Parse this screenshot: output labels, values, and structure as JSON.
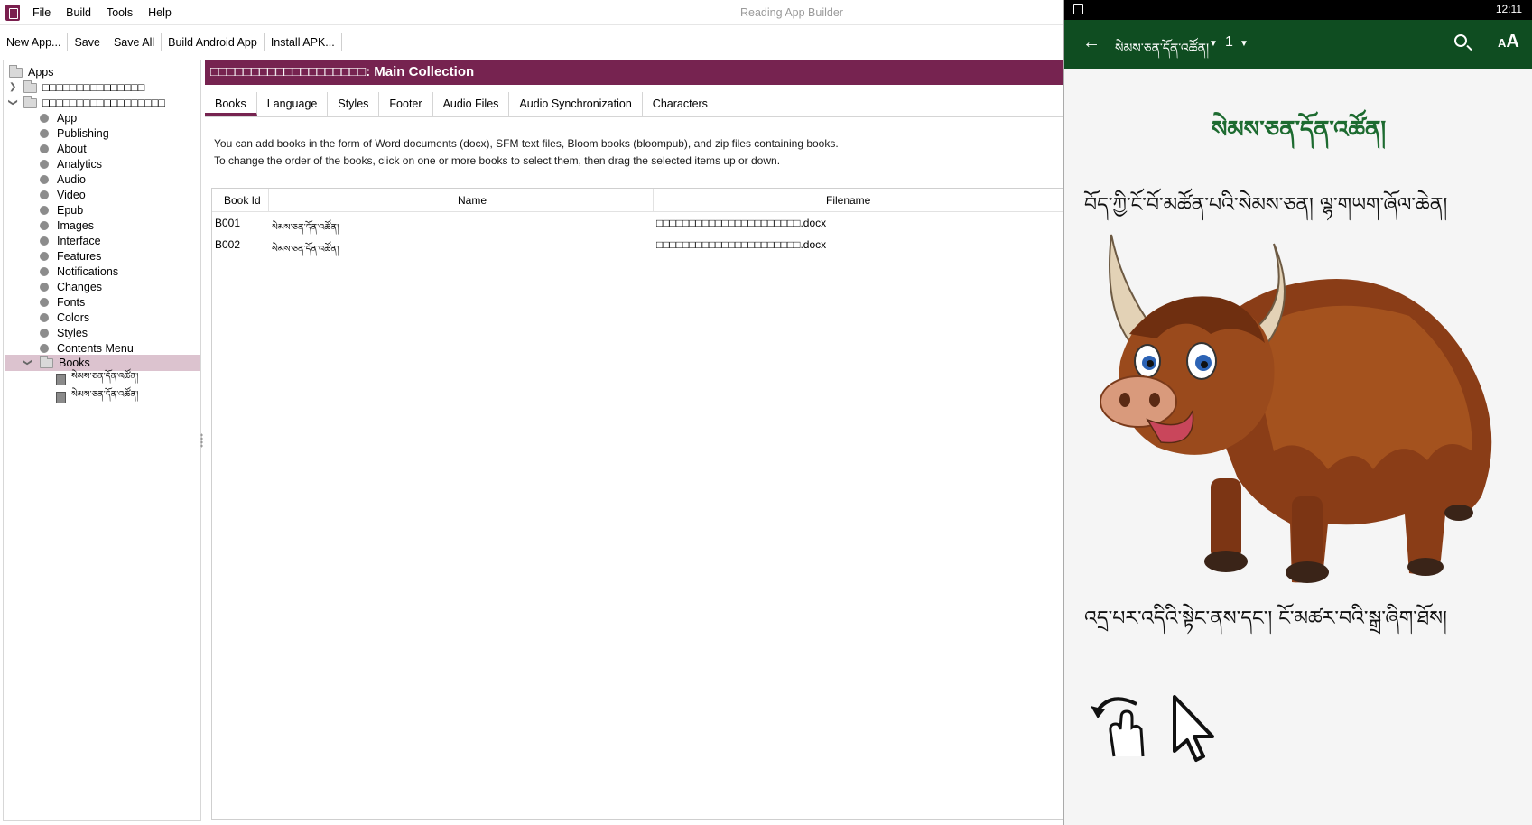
{
  "menubar": {
    "items": [
      "File",
      "Build",
      "Tools",
      "Help"
    ],
    "window_title": "Reading App Builder"
  },
  "toolbar": {
    "buttons": [
      "New App...",
      "Save",
      "Save All",
      "Build Android App",
      "Install APK..."
    ]
  },
  "tree": {
    "root": "Apps",
    "apps": [
      "□□□□□□□□□□□□□□□",
      "□□□□□□□□□□□□□□□□□□"
    ],
    "items": [
      "App",
      "Publishing",
      "About",
      "Analytics",
      "Audio",
      "Video",
      "Epub",
      "Images",
      "Interface",
      "Features",
      "Notifications",
      "Changes",
      "Fonts",
      "Colors",
      "Styles",
      "Contents Menu"
    ],
    "books_folder": "Books",
    "books": [
      "སེམས་ཅན་དོན་འཚོན།",
      "སེམས་ཅན་དོན་འཚོན།"
    ]
  },
  "collection": {
    "title": "□□□□□□□□□□□□□□□□□□□: Main Collection"
  },
  "tabs": [
    "Books",
    "Language",
    "Styles",
    "Footer",
    "Audio Files",
    "Audio Synchronization",
    "Characters"
  ],
  "info": {
    "line1": "You can add books in the form of Word documents (docx), SFM text files, Bloom books (bloompub), and zip files containing books.",
    "line2": "To change the order of the books, click on one or more books to select them, then drag the selected items up or down."
  },
  "grid": {
    "headers": [
      "Book Id",
      "Name",
      "Filename"
    ],
    "rows": [
      {
        "id": "B001",
        "name": "སེམས་ཅན་དོན་འཚོན།",
        "filename": "□□□□□□□□□□□□□□□□□□□□□□.docx"
      },
      {
        "id": "B002",
        "name": "སེམས་ཅན་དོན་འཚོན།",
        "filename": "□□□□□□□□□□□□□□□□□□□□□□.docx"
      }
    ]
  },
  "device": {
    "status_time": "12:11",
    "appbar_title": "སེམས་ཅན་དོན་འཚོན།",
    "chapter": "1",
    "font_button": "AA",
    "heading": "སེམས་ཅན་དོན་འཚོན།",
    "line1": "བོད་ཀྱི་ངོ་བོ་མཚོན་པའི་སེམས་ཅན། ལྷ་གཡག་ཞོལ་ཆེན།",
    "line2": "འདྲ་པར་འདིའི་སྟེང་ནས་དང་། ངོ་མཚར་བའི་སྒྲ་ཞིག་ཐོས།",
    "colors": {
      "appbar": "#0f4d21",
      "heading": "#1d6b30",
      "accent": "#762350"
    },
    "icons": [
      "back-arrow-icon",
      "dropdown-caret-icon",
      "search-icon",
      "tap-gesture-icon",
      "cursor-arrow-icon"
    ]
  }
}
